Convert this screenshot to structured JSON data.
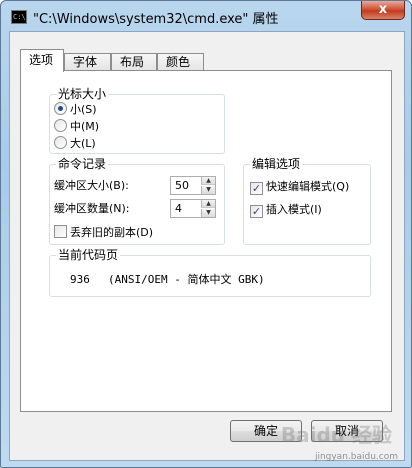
{
  "window": {
    "title": "\"C:\\Windows\\system32\\cmd.exe\" 属性",
    "close_label": "x",
    "icon_label": "C:\\."
  },
  "tabs": [
    {
      "label": "选项",
      "active": true
    },
    {
      "label": "字体"
    },
    {
      "label": "布局"
    },
    {
      "label": "颜色"
    }
  ],
  "cursor_size": {
    "legend": "光标大小",
    "options": [
      {
        "label": "小(S)",
        "checked": true
      },
      {
        "label": "中(M)",
        "checked": false
      },
      {
        "label": "大(L)",
        "checked": false
      }
    ]
  },
  "command_history": {
    "legend": "命令记录",
    "buffer_size_label": "缓冲区大小(B):",
    "buffer_size_value": "50",
    "buffer_count_label": "缓冲区数量(N):",
    "buffer_count_value": "4",
    "discard_dupes_label": "丢弃旧的副本(D)",
    "discard_dupes_checked": false
  },
  "edit_options": {
    "legend": "编辑选项",
    "quick_edit_label": "快速编辑模式(Q)",
    "quick_edit_checked": true,
    "insert_mode_label": "插入模式(I)",
    "insert_mode_checked": true
  },
  "code_page": {
    "legend": "当前代码页",
    "number": "936",
    "description": "(ANSI/OEM - 简体中文 GBK)"
  },
  "buttons": {
    "ok": "确定",
    "cancel": "取消"
  },
  "watermark": {
    "text": "Baidu 经验",
    "url": "jingyan.baidu.com"
  }
}
